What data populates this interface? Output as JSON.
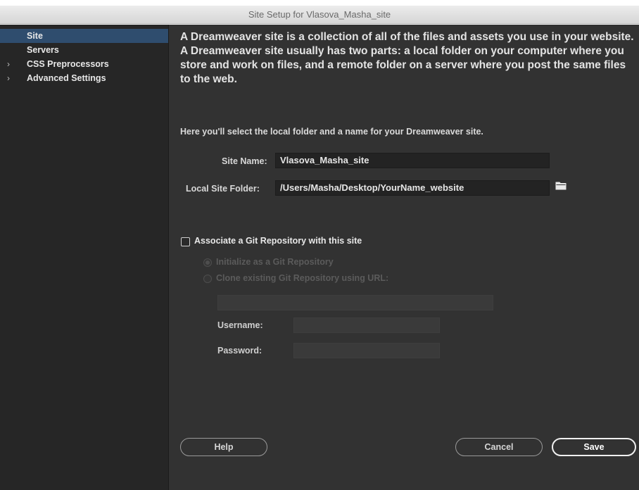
{
  "window": {
    "title": "Site Setup for Vlasova_Masha_site"
  },
  "sidebar": {
    "items": [
      {
        "label": "Site",
        "chevron": ""
      },
      {
        "label": "Servers",
        "chevron": ""
      },
      {
        "label": "CSS Preprocessors",
        "chevron": "›"
      },
      {
        "label": "Advanced Settings",
        "chevron": "›"
      }
    ]
  },
  "main": {
    "intro": "A Dreamweaver site is a collection of all of the files and assets you use in your website. A Dreamweaver site usually has two parts: a local folder on your computer where you store and work on files, and a remote folder on a server where you post the same files to the web.",
    "hint": "Here you'll select the local folder and a name for your Dreamweaver site.",
    "site_name_label": "Site Name:",
    "site_name_value": "Vlasova_Masha_site",
    "local_folder_label": "Local Site Folder:",
    "local_folder_value": "/Users/Masha/Desktop/YourName_website",
    "folder_icon": "folder-icon",
    "git": {
      "checkbox_label": "Associate a Git Repository with this site",
      "checked": false,
      "radio_init": "Initialize as a Git Repository",
      "radio_clone": "Clone existing Git Repository using URL:",
      "url_value": "",
      "username_label": "Username:",
      "username_value": "",
      "password_label": "Password:",
      "password_value": ""
    }
  },
  "buttons": {
    "help": "Help",
    "cancel": "Cancel",
    "save": "Save"
  },
  "colors": {
    "sidebar_active": "#2f4d6e",
    "window_bg": "#323232",
    "sidebar_bg": "#262626"
  }
}
